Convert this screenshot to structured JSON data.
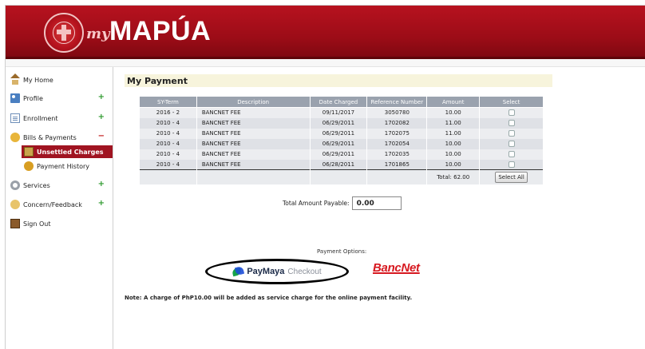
{
  "header": {
    "logo_prefix": "my",
    "logo_text": "MAPÚA",
    "brand_color": "#a0101c"
  },
  "sidebar": {
    "items": [
      {
        "label": "My Home",
        "icon": "home-icon",
        "expander": ""
      },
      {
        "label": "Profile",
        "icon": "profile-icon",
        "expander": "+"
      },
      {
        "label": "Enrollment",
        "icon": "document-icon",
        "expander": "+"
      },
      {
        "label": "Bills & Payments",
        "icon": "bills-icon",
        "expander": "−"
      },
      {
        "label": "Services",
        "icon": "gear-icon",
        "expander": "+"
      },
      {
        "label": "Concern/Feedback",
        "icon": "chat-icon",
        "expander": "+"
      },
      {
        "label": "Sign Out",
        "icon": "door-icon",
        "expander": ""
      }
    ],
    "subitems": [
      {
        "label": "Unsettled Charges",
        "active": true,
        "icon": "card-icon"
      },
      {
        "label": "Payment History",
        "active": false,
        "icon": "coins-icon"
      }
    ]
  },
  "main": {
    "title": "My Payment",
    "table": {
      "headers": [
        "SY-Term",
        "Description",
        "Date Charged",
        "Reference Number",
        "Amount",
        "Select"
      ],
      "rows": [
        {
          "term": "2016 - 2",
          "desc": "BANCNET FEE",
          "date": "09/11/2017",
          "ref": "3050780",
          "amount": "10.00"
        },
        {
          "term": "2010 - 4",
          "desc": "BANCNET FEE",
          "date": "06/29/2011",
          "ref": "1702082",
          "amount": "11.00"
        },
        {
          "term": "2010 - 4",
          "desc": "BANCNET FEE",
          "date": "06/29/2011",
          "ref": "1702075",
          "amount": "11.00"
        },
        {
          "term": "2010 - 4",
          "desc": "BANCNET FEE",
          "date": "06/29/2011",
          "ref": "1702054",
          "amount": "10.00"
        },
        {
          "term": "2010 - 4",
          "desc": "BANCNET FEE",
          "date": "06/29/2011",
          "ref": "1702035",
          "amount": "10.00"
        },
        {
          "term": "2010 - 4",
          "desc": "BANCNET FEE",
          "date": "06/28/2011",
          "ref": "1701865",
          "amount": "10.00"
        }
      ],
      "total_label": "Total: 62.00",
      "select_all_label": "Select All"
    },
    "payable_label": "Total Amount Payable:",
    "payable_value": "0.00",
    "payment_options_label": "Payment Options:",
    "paymaya_brand": "PayMaya",
    "paymaya_suffix": "Checkout",
    "bancnet_label": "BancNet",
    "note": "Note: A charge of PhP10.00 will be added as service charge for the online payment facility."
  }
}
